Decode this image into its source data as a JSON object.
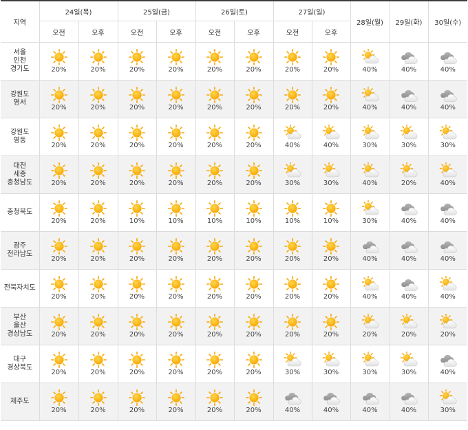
{
  "header": {
    "region_label": "지역",
    "am_label": "오전",
    "pm_label": "오후",
    "split_days": [
      "24일(목)",
      "25일(금)",
      "26일(토)",
      "27일(일)"
    ],
    "single_days": [
      "28일(월)",
      "29일(화)",
      "30일(수)"
    ]
  },
  "icon_colors": {
    "sun": "#f7a600",
    "sun_light": "#ffd54a",
    "cloud_light": "#e2e2e2",
    "cloud_dark": "#8f8f8f"
  },
  "rows": [
    {
      "region": [
        "서울",
        "인천",
        "경기도"
      ],
      "cells": [
        {
          "icon": "sunny",
          "pct": "20%"
        },
        {
          "icon": "sunny",
          "pct": "20%"
        },
        {
          "icon": "sunny",
          "pct": "20%"
        },
        {
          "icon": "sunny",
          "pct": "20%"
        },
        {
          "icon": "sunny",
          "pct": "20%"
        },
        {
          "icon": "sunny",
          "pct": "20%"
        },
        {
          "icon": "sunny",
          "pct": "20%"
        },
        {
          "icon": "sunny",
          "pct": "20%"
        },
        {
          "icon": "partly-cloudy",
          "pct": "40%"
        },
        {
          "icon": "cloudy",
          "pct": "40%"
        },
        {
          "icon": "cloudy",
          "pct": "40%"
        }
      ]
    },
    {
      "region": [
        "강원도",
        "영서"
      ],
      "cells": [
        {
          "icon": "sunny",
          "pct": "20%"
        },
        {
          "icon": "sunny",
          "pct": "20%"
        },
        {
          "icon": "sunny",
          "pct": "20%"
        },
        {
          "icon": "sunny",
          "pct": "20%"
        },
        {
          "icon": "sunny",
          "pct": "20%"
        },
        {
          "icon": "sunny",
          "pct": "20%"
        },
        {
          "icon": "sunny",
          "pct": "20%"
        },
        {
          "icon": "sunny",
          "pct": "20%"
        },
        {
          "icon": "partly-cloudy",
          "pct": "40%"
        },
        {
          "icon": "cloudy",
          "pct": "40%"
        },
        {
          "icon": "cloudy",
          "pct": "40%"
        }
      ]
    },
    {
      "region": [
        "강원도",
        "영동"
      ],
      "cells": [
        {
          "icon": "sunny",
          "pct": "20%"
        },
        {
          "icon": "sunny",
          "pct": "20%"
        },
        {
          "icon": "sunny",
          "pct": "20%"
        },
        {
          "icon": "sunny",
          "pct": "20%"
        },
        {
          "icon": "sunny",
          "pct": "20%"
        },
        {
          "icon": "sunny",
          "pct": "20%"
        },
        {
          "icon": "partly-cloudy",
          "pct": "40%"
        },
        {
          "icon": "partly-cloudy",
          "pct": "40%"
        },
        {
          "icon": "partly-cloudy",
          "pct": "30%"
        },
        {
          "icon": "partly-cloudy",
          "pct": "30%"
        },
        {
          "icon": "partly-cloudy",
          "pct": "30%"
        }
      ]
    },
    {
      "region": [
        "대전",
        "세종",
        "충청남도"
      ],
      "cells": [
        {
          "icon": "sunny",
          "pct": "20%"
        },
        {
          "icon": "sunny",
          "pct": "20%"
        },
        {
          "icon": "sunny",
          "pct": "20%"
        },
        {
          "icon": "sunny",
          "pct": "20%"
        },
        {
          "icon": "sunny",
          "pct": "20%"
        },
        {
          "icon": "sunny",
          "pct": "20%"
        },
        {
          "icon": "partly-cloudy",
          "pct": "30%"
        },
        {
          "icon": "partly-cloudy",
          "pct": "30%"
        },
        {
          "icon": "partly-cloudy",
          "pct": "40%"
        },
        {
          "icon": "partly-cloudy",
          "pct": "20%"
        },
        {
          "icon": "partly-cloudy",
          "pct": "40%"
        }
      ]
    },
    {
      "region": [
        "충청북도"
      ],
      "cells": [
        {
          "icon": "sunny",
          "pct": "20%"
        },
        {
          "icon": "sunny",
          "pct": "20%"
        },
        {
          "icon": "sunny",
          "pct": "10%"
        },
        {
          "icon": "sunny",
          "pct": "10%"
        },
        {
          "icon": "sunny",
          "pct": "10%"
        },
        {
          "icon": "sunny",
          "pct": "10%"
        },
        {
          "icon": "sunny",
          "pct": "10%"
        },
        {
          "icon": "sunny",
          "pct": "10%"
        },
        {
          "icon": "partly-cloudy",
          "pct": "30%"
        },
        {
          "icon": "cloudy",
          "pct": "40%"
        },
        {
          "icon": "cloudy",
          "pct": "40%"
        }
      ]
    },
    {
      "region": [
        "광주",
        "전라남도"
      ],
      "cells": [
        {
          "icon": "sunny",
          "pct": "20%"
        },
        {
          "icon": "sunny",
          "pct": "20%"
        },
        {
          "icon": "sunny",
          "pct": "20%"
        },
        {
          "icon": "sunny",
          "pct": "20%"
        },
        {
          "icon": "sunny",
          "pct": "20%"
        },
        {
          "icon": "sunny",
          "pct": "20%"
        },
        {
          "icon": "sunny",
          "pct": "20%"
        },
        {
          "icon": "sunny",
          "pct": "20%"
        },
        {
          "icon": "cloudy",
          "pct": "40%"
        },
        {
          "icon": "cloudy",
          "pct": "40%"
        },
        {
          "icon": "cloudy",
          "pct": "40%"
        }
      ]
    },
    {
      "region": [
        "전북자치도"
      ],
      "cells": [
        {
          "icon": "sunny",
          "pct": "20%"
        },
        {
          "icon": "sunny",
          "pct": "20%"
        },
        {
          "icon": "sunny",
          "pct": "20%"
        },
        {
          "icon": "sunny",
          "pct": "20%"
        },
        {
          "icon": "sunny",
          "pct": "20%"
        },
        {
          "icon": "sunny",
          "pct": "20%"
        },
        {
          "icon": "sunny",
          "pct": "20%"
        },
        {
          "icon": "sunny",
          "pct": "20%"
        },
        {
          "icon": "partly-cloudy",
          "pct": "40%"
        },
        {
          "icon": "cloudy",
          "pct": "40%"
        },
        {
          "icon": "partly-cloudy",
          "pct": "40%"
        }
      ]
    },
    {
      "region": [
        "부산",
        "울산",
        "경상남도"
      ],
      "cells": [
        {
          "icon": "sunny",
          "pct": "20%"
        },
        {
          "icon": "sunny",
          "pct": "20%"
        },
        {
          "icon": "sunny",
          "pct": "20%"
        },
        {
          "icon": "sunny",
          "pct": "20%"
        },
        {
          "icon": "sunny",
          "pct": "20%"
        },
        {
          "icon": "sunny",
          "pct": "20%"
        },
        {
          "icon": "sunny",
          "pct": "20%"
        },
        {
          "icon": "sunny",
          "pct": "20%"
        },
        {
          "icon": "partly-cloudy",
          "pct": "20%"
        },
        {
          "icon": "partly-cloudy",
          "pct": "20%"
        },
        {
          "icon": "partly-cloudy",
          "pct": "20%"
        }
      ]
    },
    {
      "region": [
        "대구",
        "경상북도"
      ],
      "cells": [
        {
          "icon": "sunny",
          "pct": "20%"
        },
        {
          "icon": "sunny",
          "pct": "20%"
        },
        {
          "icon": "sunny",
          "pct": "20%"
        },
        {
          "icon": "sunny",
          "pct": "20%"
        },
        {
          "icon": "sunny",
          "pct": "20%"
        },
        {
          "icon": "sunny",
          "pct": "20%"
        },
        {
          "icon": "partly-cloudy",
          "pct": "30%"
        },
        {
          "icon": "partly-cloudy",
          "pct": "30%"
        },
        {
          "icon": "partly-cloudy",
          "pct": "30%"
        },
        {
          "icon": "partly-cloudy",
          "pct": "30%"
        },
        {
          "icon": "cloudy",
          "pct": "40%"
        }
      ]
    },
    {
      "region": [
        "제주도"
      ],
      "cells": [
        {
          "icon": "sunny",
          "pct": "20%"
        },
        {
          "icon": "sunny",
          "pct": "20%"
        },
        {
          "icon": "sunny",
          "pct": "20%"
        },
        {
          "icon": "sunny",
          "pct": "20%"
        },
        {
          "icon": "sunny",
          "pct": "20%"
        },
        {
          "icon": "sunny",
          "pct": "20%"
        },
        {
          "icon": "cloudy",
          "pct": "40%"
        },
        {
          "icon": "cloudy",
          "pct": "40%"
        },
        {
          "icon": "cloudy",
          "pct": "40%"
        },
        {
          "icon": "cloudy",
          "pct": "40%"
        },
        {
          "icon": "partly-cloudy",
          "pct": "30%"
        }
      ]
    }
  ]
}
